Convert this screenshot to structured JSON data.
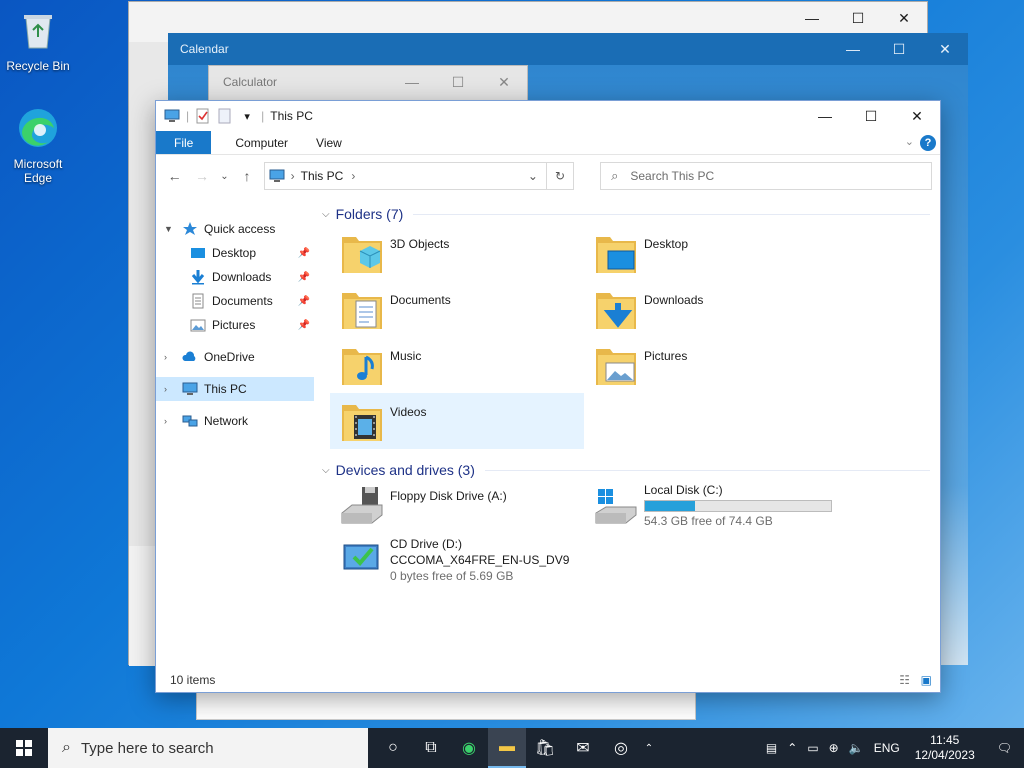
{
  "desktop": {
    "icons": [
      {
        "label": "Recycle Bin"
      },
      {
        "label": "Microsoft Edge"
      }
    ]
  },
  "background_windows": {
    "calendar_title": "Calendar",
    "calculator_title": "Calculator"
  },
  "explorer": {
    "title": "This PC",
    "tabs": {
      "file": "File",
      "computer": "Computer",
      "view": "View"
    },
    "address": {
      "location": "This PC"
    },
    "search": {
      "placeholder": "Search This PC"
    },
    "nav": {
      "quick_access": "Quick access",
      "desktop": "Desktop",
      "downloads": "Downloads",
      "documents": "Documents",
      "pictures": "Pictures",
      "onedrive": "OneDrive",
      "this_pc": "This PC",
      "network": "Network"
    },
    "folders_header": "Folders (7)",
    "folders": [
      {
        "name": "3D Objects"
      },
      {
        "name": "Desktop"
      },
      {
        "name": "Documents"
      },
      {
        "name": "Downloads"
      },
      {
        "name": "Music"
      },
      {
        "name": "Pictures"
      },
      {
        "name": "Videos"
      }
    ],
    "devices_header": "Devices and drives (3)",
    "drives": {
      "floppy": {
        "name": "Floppy Disk Drive (A:)"
      },
      "local": {
        "name": "Local Disk (C:)",
        "free": "54.3 GB free of 74.4 GB",
        "used_fraction": 0.27
      },
      "cd": {
        "name": "CD Drive (D:)",
        "label": "CCCOMA_X64FRE_EN-US_DV9",
        "free": "0 bytes free of 5.69 GB"
      }
    },
    "status": {
      "items": "10 items"
    }
  },
  "taskbar": {
    "search_placeholder": "Type here to search",
    "lang": "ENG",
    "time": "11:45",
    "date": "12/04/2023"
  },
  "colors": {
    "accent": "#1979ca",
    "selected": "#cce8ff",
    "folder": "#f3c746"
  }
}
